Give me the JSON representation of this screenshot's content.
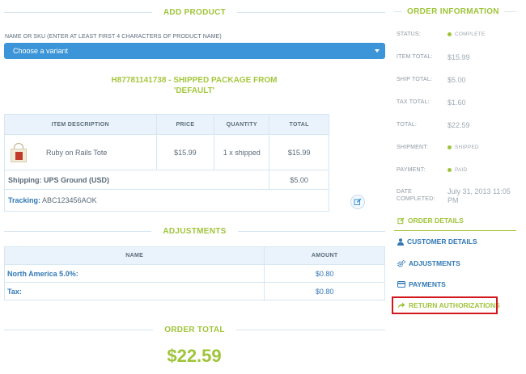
{
  "add_product": {
    "title": "ADD PRODUCT",
    "field_label": "NAME OR SKU (ENTER AT LEAST FIRST 4 CHARACTERS OF PRODUCT NAME)",
    "select_placeholder": "Choose a variant"
  },
  "shipment": {
    "number": "H87781141738",
    "title_rest": " - SHIPPED PACKAGE FROM",
    "from": "'DEFAULT'",
    "columns": [
      "ITEM DESCRIPTION",
      "PRICE",
      "QUANTITY",
      "TOTAL"
    ],
    "item": {
      "description": "Ruby on Rails Tote",
      "price": "$15.99",
      "quantity": "1 x shipped",
      "total": "$15.99"
    },
    "shipping_label": "Shipping: UPS Ground (USD)",
    "shipping_amount": "$5.00",
    "tracking_label": "Tracking:",
    "tracking_value": "ABC123456AOK"
  },
  "adjustments": {
    "title": "ADJUSTMENTS",
    "columns": [
      "NAME",
      "AMOUNT"
    ],
    "rows": [
      {
        "name": "North America 5.0%:",
        "amount": "$0.80"
      },
      {
        "name": "Tax:",
        "amount": "$0.80"
      }
    ]
  },
  "order_total": {
    "title": "ORDER TOTAL",
    "value": "$22.59"
  },
  "order_info": {
    "title": "ORDER INFORMATION",
    "status_label": "STATUS:",
    "status_value": "COMPLETE",
    "item_total_label": "ITEM TOTAL:",
    "item_total_value": "$15.99",
    "ship_total_label": "SHIP TOTAL:",
    "ship_total_value": "$5.00",
    "tax_total_label": "TAX TOTAL:",
    "tax_total_value": "$1.60",
    "total_label": "TOTAL:",
    "total_value": "$22.59",
    "shipment_label": "SHIPMENT:",
    "shipment_value": "SHIPPED",
    "payment_label": "PAYMENT:",
    "payment_value": "PAID",
    "completed_label_1": "DATE",
    "completed_label_2": "COMPLETED:",
    "completed_value": "July 31, 2013 11:05 PM"
  },
  "nav": {
    "order_details": "ORDER DETAILS",
    "customer_details": "CUSTOMER DETAILS",
    "adjustments": "ADJUSTMENTS",
    "payments": "PAYMENTS",
    "return_authorizations": "RETURN AUTHORIZATIONS"
  },
  "colors": {
    "accent_green": "#9fc43a",
    "link_blue": "#3178b6",
    "select_blue": "#3c95d8",
    "highlight_red": "#d2161b"
  },
  "icons": [
    "caret-down-icon",
    "edit-icon",
    "order-details-icon",
    "user-icon",
    "gears-icon",
    "credit-card-icon",
    "share-icon"
  ]
}
